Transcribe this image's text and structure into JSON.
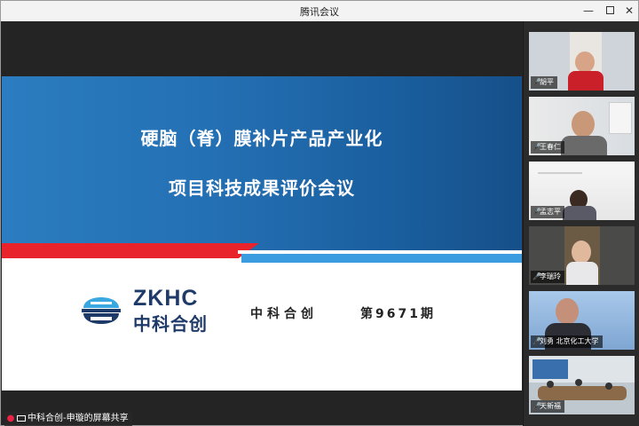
{
  "window": {
    "title": "腾讯会议"
  },
  "slide": {
    "title_line1": "硬脑（脊）膜补片产品产业化",
    "title_line2": "项目科技成果评价会议",
    "logo_en": "ZKHC",
    "logo_cn": "中科合创",
    "org": "中科合创",
    "issue": "第9671期"
  },
  "sharer": {
    "label": "中科合创-申璇的屏幕共享"
  },
  "participants": [
    {
      "name": "胡平",
      "mic": "on"
    },
    {
      "name": "王春仁",
      "mic": "off"
    },
    {
      "name": "孟志平",
      "mic": "off"
    },
    {
      "name": "李瑞玲",
      "mic": "off"
    },
    {
      "name": "刘勇  北京化工大学",
      "mic": "on"
    },
    {
      "name": "天新福",
      "mic": "off"
    }
  ],
  "colors": {
    "slide_blue": "#2470b4",
    "red_stripe": "#e8232c",
    "light_blue_stripe": "#3b9de0",
    "logo_navy": "#1e3a68"
  }
}
